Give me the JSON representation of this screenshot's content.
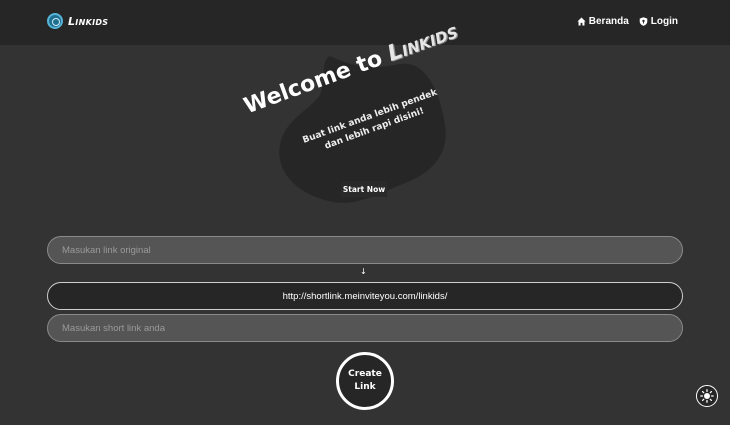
{
  "navbar": {
    "brand": "Linkids",
    "links": [
      {
        "label": "Beranda",
        "icon": "home-icon"
      },
      {
        "label": "Login",
        "icon": "shield-icon"
      }
    ]
  },
  "hero": {
    "title_prefix": "Welcome to",
    "title_brand": "Linkids",
    "subtitle_line1": "Buat link anda lebih pendek",
    "subtitle_line2": "dan lebih rapi disini!",
    "start_label": "Start Now",
    "blob_color": "#262626"
  },
  "form": {
    "original_placeholder": "Masukan link original",
    "arrow": "↓",
    "base_url": "http://shortlink.meinviteyou.com/linkids/",
    "short_placeholder": "Masukan short link anda",
    "create_label": "Create Link"
  },
  "theme_toggle": {
    "icon": "sun-icon"
  },
  "colors": {
    "background": "#333333",
    "navbar": "#262626",
    "input_light": "#555555",
    "input_dark": "#262626"
  }
}
